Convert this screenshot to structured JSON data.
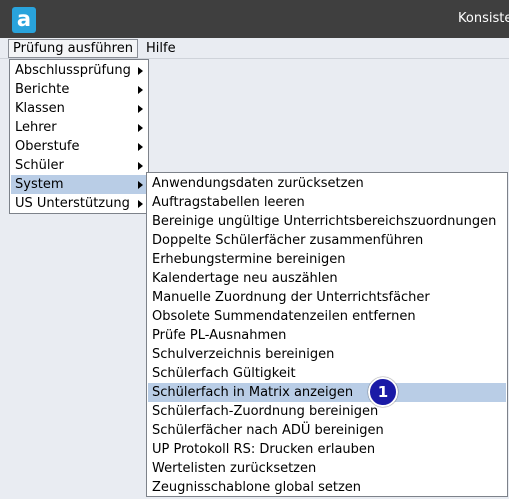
{
  "window": {
    "title": "Konsiste",
    "logo_letter": "a"
  },
  "menubar": {
    "items": [
      "Prüfung ausführen",
      "Hilfe"
    ]
  },
  "main_menu": {
    "items": [
      "Abschlussprüfung",
      "Berichte",
      "Klassen",
      "Lehrer",
      "Oberstufe",
      "Schüler",
      "System",
      "US Unterstützung"
    ],
    "active_item": "System"
  },
  "system_submenu": {
    "items": [
      "Anwendungsdaten zurücksetzen",
      "Auftragstabellen leeren",
      "Bereinige ungültige Unterrichtsbereichszuordnungen",
      "Doppelte Schülerfächer zusammenführen",
      "Erhebungstermine bereinigen",
      "Kalendertage neu auszählen",
      "Manuelle Zuordnung der Unterrichtsfächer",
      "Obsolete Summendatenzeilen entfernen",
      "Prüfe PL-Ausnahmen",
      "Schulverzeichnis bereinigen",
      "Schülerfach Gültigkeit",
      "Schülerfach in Matrix anzeigen",
      "Schülerfach-Zuordnung bereinigen",
      "Schülerfächer nach ADÜ bereinigen",
      "UP Protokoll RS: Drucken erlauben",
      "Wertelisten zurücksetzen",
      "Zeugnisschablone global setzen"
    ],
    "highlighted_item": "Schülerfach in Matrix anzeigen"
  },
  "callout": {
    "label": "1",
    "color": "#1a1aa6"
  },
  "colors": {
    "titlebar": "#3f3f3f",
    "logo": "#29a3dc",
    "highlight": "#b9cde6"
  }
}
